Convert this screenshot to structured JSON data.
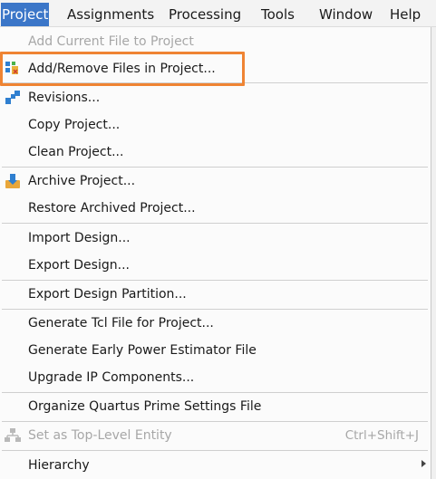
{
  "menubar": {
    "items": [
      {
        "label": "Project"
      },
      {
        "label": "Assignments"
      },
      {
        "label": "Processing"
      },
      {
        "label": "Tools"
      },
      {
        "label": "Window"
      },
      {
        "label": "Help"
      }
    ]
  },
  "menu": {
    "items": [
      {
        "label": "Add Current File to Project"
      },
      {
        "label": "Add/Remove Files in Project..."
      },
      {
        "label": "Revisions..."
      },
      {
        "label": "Copy Project..."
      },
      {
        "label": "Clean Project..."
      },
      {
        "label": "Archive Project..."
      },
      {
        "label": "Restore Archived Project..."
      },
      {
        "label": "Import Design..."
      },
      {
        "label": "Export Design..."
      },
      {
        "label": "Export Design Partition..."
      },
      {
        "label": "Generate Tcl File for Project..."
      },
      {
        "label": "Generate Early Power Estimator File"
      },
      {
        "label": "Upgrade IP Components..."
      },
      {
        "label": "Organize Quartus Prime Settings File"
      },
      {
        "label": "Set as Top-Level Entity",
        "shortcut": "Ctrl+Shift+J"
      },
      {
        "label": "Hierarchy"
      }
    ]
  },
  "colors": {
    "highlight_border": "#ef8433",
    "menubar_active": "#3b76c8",
    "disabled_text": "#a7a7a7"
  },
  "icons": [
    "files-icon",
    "revisions-icon",
    "archive-icon",
    "hierarchy-entity-icon",
    "submenu-arrow-icon"
  ]
}
